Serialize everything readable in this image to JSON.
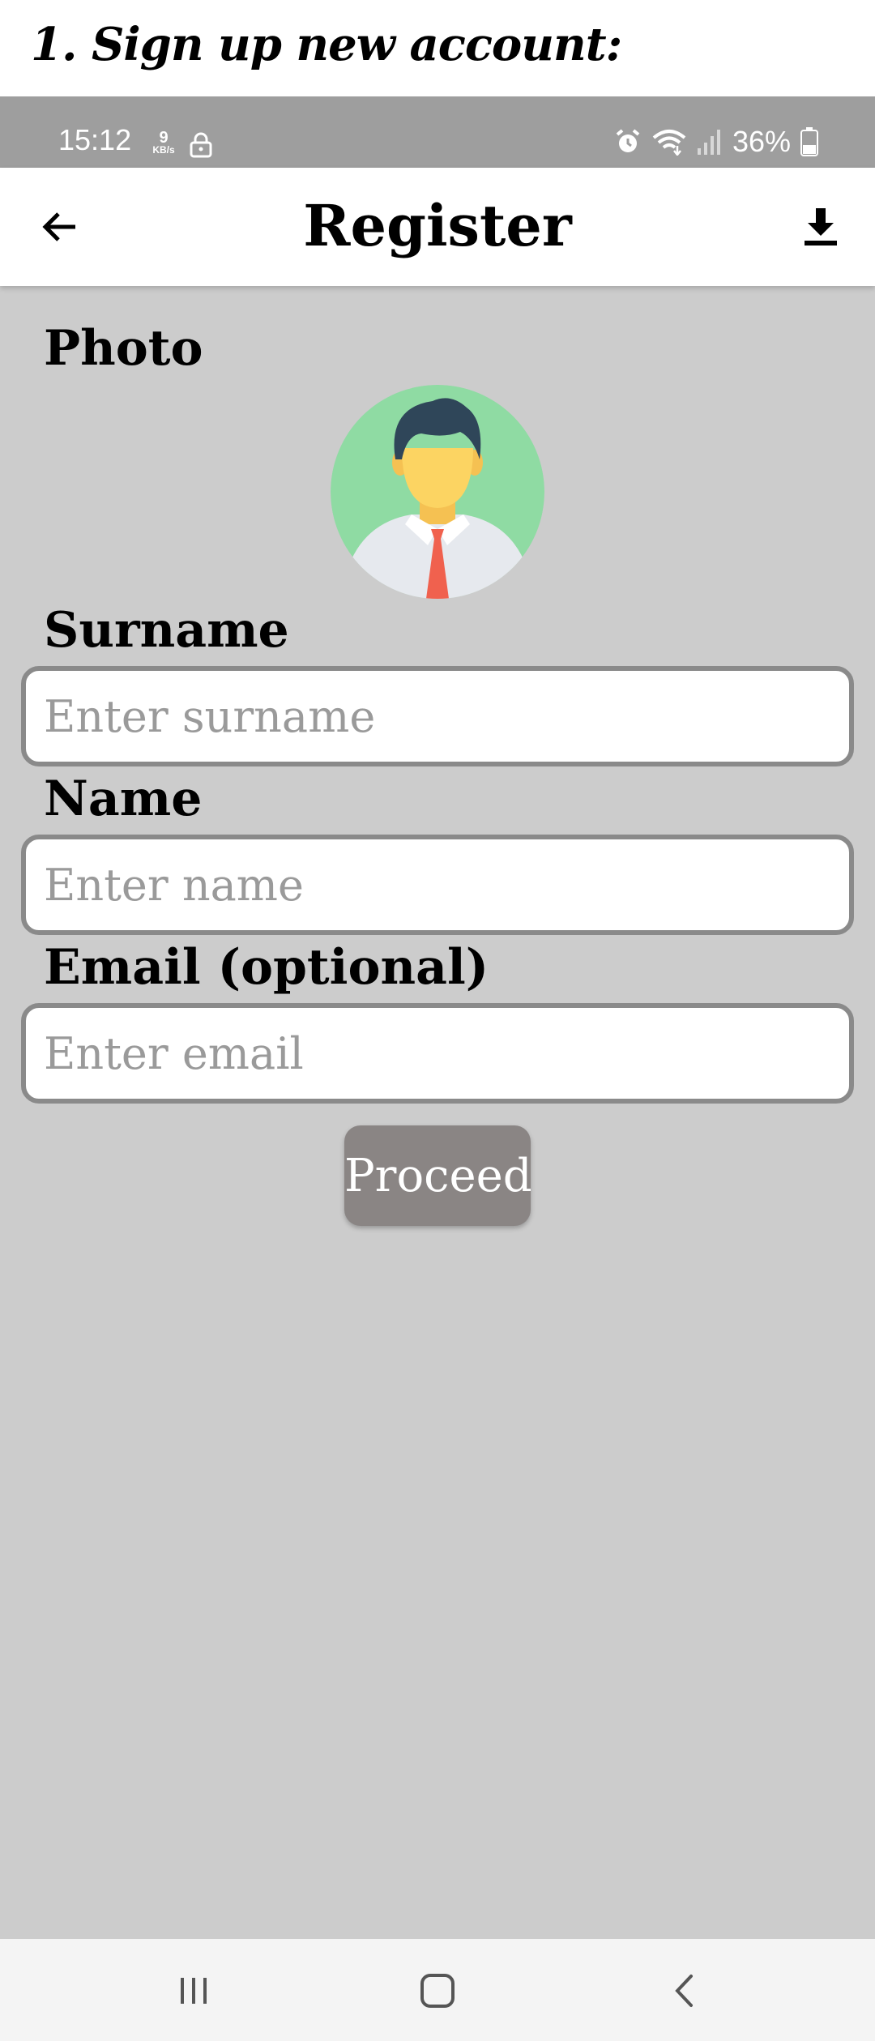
{
  "caption": "1. Sign up new account:",
  "status_bar": {
    "time": "15:12",
    "speed_value": "9",
    "speed_unit": "KB/s",
    "battery": "36%",
    "icons": [
      "lock-icon",
      "alarm-icon",
      "wifi-icon",
      "signal-icon",
      "battery-icon"
    ]
  },
  "app_bar": {
    "title": "Register",
    "back_icon": "arrow-left-icon",
    "download_icon": "download-icon"
  },
  "form": {
    "photo_label": "Photo",
    "surname_label": "Surname",
    "surname_placeholder": "Enter surname",
    "surname_value": "",
    "name_label": "Name",
    "name_placeholder": "Enter name",
    "name_value": "",
    "email_label": "Email (optional)",
    "email_placeholder": "Enter email",
    "email_value": "",
    "proceed_label": "Proceed"
  },
  "nav_bar": {
    "icons": [
      "recent-apps-icon",
      "home-icon",
      "back-icon"
    ]
  },
  "colors": {
    "background": "#cccccc",
    "status_bar": "#9e9e9e",
    "proceed_button": "#8a8584",
    "input_border": "#8a8a8a",
    "avatar_bg": "#8fdba3"
  }
}
